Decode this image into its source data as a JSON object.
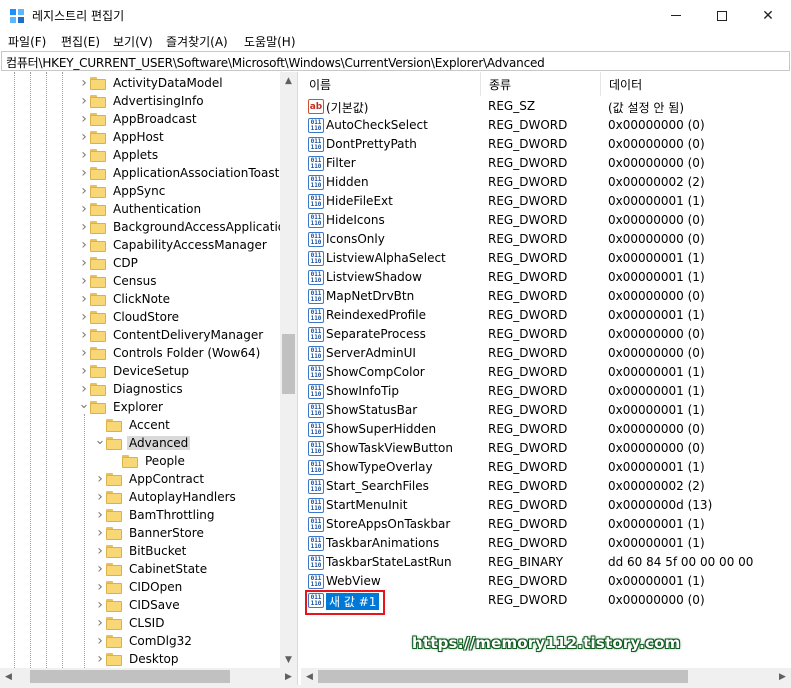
{
  "window": {
    "title": "레지스트리 편집기",
    "icon": "registry-editor-icon"
  },
  "menu": [
    "파일(F)",
    "편집(E)",
    "보기(V)",
    "즐겨찾기(A)",
    "도움말(H)"
  ],
  "address": "컴퓨터\\HKEY_CURRENT_USER\\Software\\Microsoft\\Windows\\CurrentVersion\\Explorer\\Advanced",
  "tree": {
    "items": [
      {
        "label": "ActivityDataModel",
        "expanded": false
      },
      {
        "label": "AdvertisingInfo",
        "expanded": false
      },
      {
        "label": "AppBroadcast",
        "expanded": false
      },
      {
        "label": "AppHost",
        "expanded": false
      },
      {
        "label": "Applets",
        "expanded": false
      },
      {
        "label": "ApplicationAssociationToasts",
        "expanded": false
      },
      {
        "label": "AppSync",
        "expanded": false
      },
      {
        "label": "Authentication",
        "expanded": false
      },
      {
        "label": "BackgroundAccessApplications",
        "expanded": false
      },
      {
        "label": "CapabilityAccessManager",
        "expanded": false
      },
      {
        "label": "CDP",
        "expanded": false
      },
      {
        "label": "Census",
        "expanded": false
      },
      {
        "label": "ClickNote",
        "expanded": false
      },
      {
        "label": "CloudStore",
        "expanded": false
      },
      {
        "label": "ContentDeliveryManager",
        "expanded": false
      },
      {
        "label": "Controls Folder (Wow64)",
        "expanded": false
      },
      {
        "label": "DeviceSetup",
        "expanded": false
      },
      {
        "label": "Diagnostics",
        "expanded": false
      },
      {
        "label": "Explorer",
        "expanded": true
      },
      {
        "label": "Accent",
        "expanded": false
      },
      {
        "label": "Advanced",
        "expanded": true,
        "selected": true
      },
      {
        "label": "People",
        "expanded": false
      },
      {
        "label": "AppContract",
        "expanded": false
      },
      {
        "label": "AutoplayHandlers",
        "expanded": false
      },
      {
        "label": "BamThrottling",
        "expanded": false
      },
      {
        "label": "BannerStore",
        "expanded": false
      },
      {
        "label": "BitBucket",
        "expanded": false
      },
      {
        "label": "CabinetState",
        "expanded": false
      },
      {
        "label": "CIDOpen",
        "expanded": false
      },
      {
        "label": "CIDSave",
        "expanded": false
      },
      {
        "label": "CLSID",
        "expanded": false
      },
      {
        "label": "ComDlg32",
        "expanded": false
      },
      {
        "label": "Desktop",
        "expanded": false
      }
    ]
  },
  "list": {
    "columns": [
      "이름",
      "종류",
      "데이터"
    ],
    "rows": [
      {
        "name": "(기본값)",
        "type": "REG_SZ",
        "data": "(값 설정 안 됨)",
        "icon": "string-value-icon"
      },
      {
        "name": "AutoCheckSelect",
        "type": "REG_DWORD",
        "data": "0x00000000 (0)",
        "icon": "dword-value-icon"
      },
      {
        "name": "DontPrettyPath",
        "type": "REG_DWORD",
        "data": "0x00000000 (0)",
        "icon": "dword-value-icon"
      },
      {
        "name": "Filter",
        "type": "REG_DWORD",
        "data": "0x00000000 (0)",
        "icon": "dword-value-icon"
      },
      {
        "name": "Hidden",
        "type": "REG_DWORD",
        "data": "0x00000002 (2)",
        "icon": "dword-value-icon"
      },
      {
        "name": "HideFileExt",
        "type": "REG_DWORD",
        "data": "0x00000001 (1)",
        "icon": "dword-value-icon"
      },
      {
        "name": "HideIcons",
        "type": "REG_DWORD",
        "data": "0x00000000 (0)",
        "icon": "dword-value-icon"
      },
      {
        "name": "IconsOnly",
        "type": "REG_DWORD",
        "data": "0x00000000 (0)",
        "icon": "dword-value-icon"
      },
      {
        "name": "ListviewAlphaSelect",
        "type": "REG_DWORD",
        "data": "0x00000001 (1)",
        "icon": "dword-value-icon"
      },
      {
        "name": "ListviewShadow",
        "type": "REG_DWORD",
        "data": "0x00000001 (1)",
        "icon": "dword-value-icon"
      },
      {
        "name": "MapNetDrvBtn",
        "type": "REG_DWORD",
        "data": "0x00000000 (0)",
        "icon": "dword-value-icon"
      },
      {
        "name": "ReindexedProfile",
        "type": "REG_DWORD",
        "data": "0x00000001 (1)",
        "icon": "dword-value-icon"
      },
      {
        "name": "SeparateProcess",
        "type": "REG_DWORD",
        "data": "0x00000000 (0)",
        "icon": "dword-value-icon"
      },
      {
        "name": "ServerAdminUI",
        "type": "REG_DWORD",
        "data": "0x00000000 (0)",
        "icon": "dword-value-icon"
      },
      {
        "name": "ShowCompColor",
        "type": "REG_DWORD",
        "data": "0x00000001 (1)",
        "icon": "dword-value-icon"
      },
      {
        "name": "ShowInfoTip",
        "type": "REG_DWORD",
        "data": "0x00000001 (1)",
        "icon": "dword-value-icon"
      },
      {
        "name": "ShowStatusBar",
        "type": "REG_DWORD",
        "data": "0x00000001 (1)",
        "icon": "dword-value-icon"
      },
      {
        "name": "ShowSuperHidden",
        "type": "REG_DWORD",
        "data": "0x00000000 (0)",
        "icon": "dword-value-icon"
      },
      {
        "name": "ShowTaskViewButton",
        "type": "REG_DWORD",
        "data": "0x00000000 (0)",
        "icon": "dword-value-icon"
      },
      {
        "name": "ShowTypeOverlay",
        "type": "REG_DWORD",
        "data": "0x00000001 (1)",
        "icon": "dword-value-icon"
      },
      {
        "name": "Start_SearchFiles",
        "type": "REG_DWORD",
        "data": "0x00000002 (2)",
        "icon": "dword-value-icon"
      },
      {
        "name": "StartMenuInit",
        "type": "REG_DWORD",
        "data": "0x0000000d (13)",
        "icon": "dword-value-icon"
      },
      {
        "name": "StoreAppsOnTaskbar",
        "type": "REG_DWORD",
        "data": "0x00000001 (1)",
        "icon": "dword-value-icon"
      },
      {
        "name": "TaskbarAnimations",
        "type": "REG_DWORD",
        "data": "0x00000001 (1)",
        "icon": "dword-value-icon"
      },
      {
        "name": "TaskbarStateLastRun",
        "type": "REG_BINARY",
        "data": "dd 60 84 5f 00 00 00 00",
        "icon": "binary-value-icon"
      },
      {
        "name": "WebView",
        "type": "REG_DWORD",
        "data": "0x00000001 (1)",
        "icon": "dword-value-icon"
      },
      {
        "name": "새 값 #1",
        "type": "REG_DWORD",
        "data": "0x00000000 (0)",
        "icon": "dword-value-icon",
        "editing": true
      }
    ]
  },
  "watermark": "https://memory112.tistory.com",
  "colors": {
    "selection": "#0078d7",
    "highlight_box": "#e8141b",
    "folder": "#f8d776"
  }
}
